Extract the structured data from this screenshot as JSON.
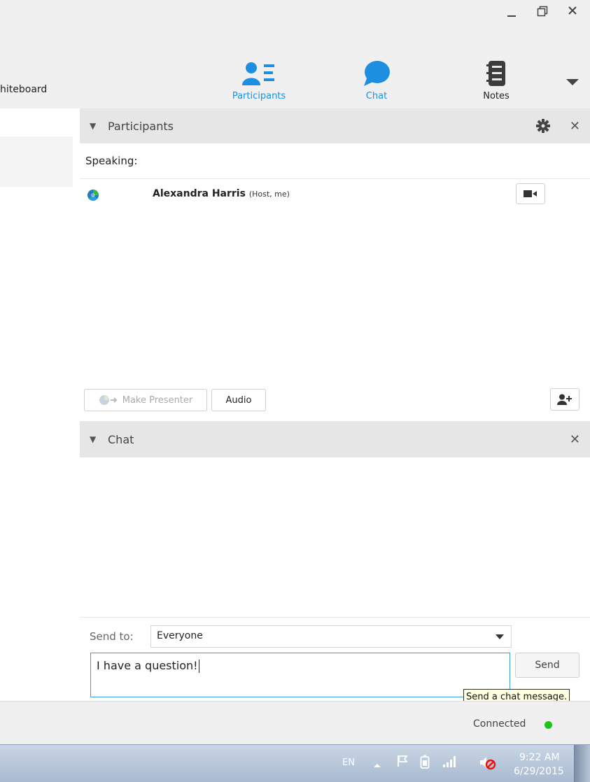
{
  "window": {
    "minimize_label": "_",
    "restore_label": "restore",
    "close_label": "✕"
  },
  "toolbar": {
    "left_tab_label": "hiteboard",
    "participants_label": "Participants",
    "chat_label": "Chat",
    "notes_label": "Notes",
    "active_color": "#1d8fe0"
  },
  "participants_panel": {
    "title": "Participants",
    "speaking_label": "Speaking:",
    "participants": [
      {
        "name": "Alexandra Harris",
        "role": "(Host, me)"
      }
    ],
    "make_presenter_label": "Make Presenter",
    "audio_label": "Audio"
  },
  "chat_panel": {
    "title": "Chat",
    "send_to_label": "Send to:",
    "send_to_value": "Everyone",
    "message_value": "I have a question!",
    "send_label": "Send",
    "send_tooltip": "Send a chat message."
  },
  "status": {
    "connection_text": "Connected",
    "connection_color": "#22c21b"
  },
  "taskbar": {
    "language": "EN",
    "time": "9:22 AM",
    "date": "6/29/2015",
    "icons": [
      "tray-expand-icon",
      "action-center-flag-icon",
      "battery-icon",
      "signal-icon",
      "volume-muted-icon"
    ]
  }
}
